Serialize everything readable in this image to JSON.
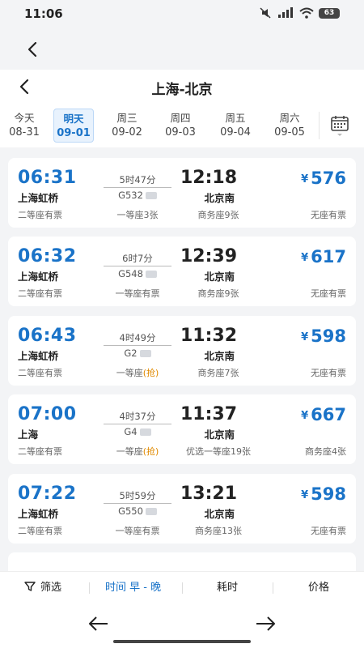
{
  "status_bar": {
    "time": "11:06",
    "battery": "63"
  },
  "header": {
    "title": "上海-北京",
    "dates": [
      {
        "week": "今天",
        "date": "08-31",
        "active": false
      },
      {
        "week": "明天",
        "date": "09-01",
        "active": true
      },
      {
        "week": "周三",
        "date": "09-02",
        "active": false
      },
      {
        "week": "周四",
        "date": "09-03",
        "active": false
      },
      {
        "week": "周五",
        "date": "09-04",
        "active": false
      },
      {
        "week": "周六",
        "date": "09-05",
        "active": false
      }
    ]
  },
  "trains": [
    {
      "dep_time": "06:31",
      "dep_station": "上海虹桥",
      "duration": "5时47分",
      "train_no": "G532",
      "arr_time": "12:18",
      "arr_station": "北京南",
      "price_symbol": "¥",
      "price": "576",
      "seat1": "二等座有票",
      "seat2": "一等座3张",
      "seat2_grab": "",
      "seat3": "商务座9张",
      "seat4": "无座有票"
    },
    {
      "dep_time": "06:32",
      "dep_station": "上海虹桥",
      "duration": "6时7分",
      "train_no": "G548",
      "arr_time": "12:39",
      "arr_station": "北京南",
      "price_symbol": "¥",
      "price": "617",
      "seat1": "二等座有票",
      "seat2": "一等座有票",
      "seat2_grab": "",
      "seat3": "商务座9张",
      "seat4": "无座有票"
    },
    {
      "dep_time": "06:43",
      "dep_station": "上海虹桥",
      "duration": "4时49分",
      "train_no": "G2",
      "arr_time": "11:32",
      "arr_station": "北京南",
      "price_symbol": "¥",
      "price": "598",
      "seat1": "二等座有票",
      "seat2": "一等座",
      "seat2_grab": "(抢)",
      "seat3": "商务座7张",
      "seat4": "无座有票"
    },
    {
      "dep_time": "07:00",
      "dep_station": "上海",
      "duration": "4时37分",
      "train_no": "G4",
      "arr_time": "11:37",
      "arr_station": "北京南",
      "price_symbol": "¥",
      "price": "667",
      "seat1": "二等座有票",
      "seat2": "一等座",
      "seat2_grab": "(抢)",
      "seat3": "优选一等座19张",
      "seat4": "商务座4张"
    },
    {
      "dep_time": "07:22",
      "dep_station": "上海虹桥",
      "duration": "5时59分",
      "train_no": "G550",
      "arr_time": "13:21",
      "arr_station": "北京南",
      "price_symbol": "¥",
      "price": "598",
      "seat1": "二等座有票",
      "seat2": "一等座有票",
      "seat2_grab": "",
      "seat3": "商务座13张",
      "seat4": "无座有票"
    }
  ],
  "filter_bar": {
    "filter": "筛选",
    "time": "时间 早 - 晚",
    "duration": "耗时",
    "price": "价格"
  },
  "colors": {
    "accent": "#1a73c8",
    "grab": "#e08a00"
  },
  "icons": [
    "back-icon",
    "calendar-icon",
    "filter-funnel-icon",
    "arrow-left-icon",
    "arrow-right-icon"
  ]
}
